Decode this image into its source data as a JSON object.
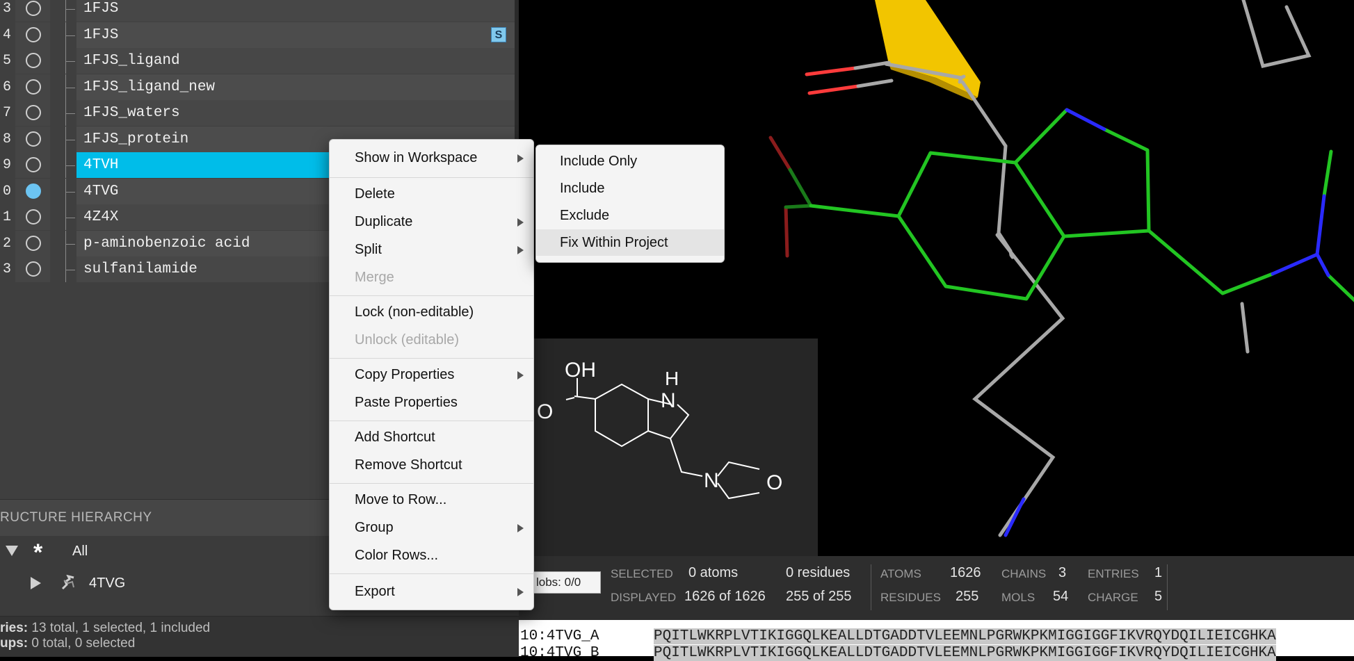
{
  "entries": [
    {
      "num": "3",
      "title": "1FJS",
      "included": false,
      "selected": false,
      "shortcut": ""
    },
    {
      "num": "4",
      "title": "1FJS",
      "included": false,
      "selected": false,
      "shortcut": "S"
    },
    {
      "num": "5",
      "title": "1FJS_ligand",
      "included": false,
      "selected": false,
      "shortcut": ""
    },
    {
      "num": "6",
      "title": "1FJS_ligand_new",
      "included": false,
      "selected": false,
      "shortcut": ""
    },
    {
      "num": "7",
      "title": "1FJS_waters",
      "included": false,
      "selected": false,
      "shortcut": ""
    },
    {
      "num": "8",
      "title": "1FJS_protein",
      "included": false,
      "selected": false,
      "shortcut": ""
    },
    {
      "num": "9",
      "title": "4TVH",
      "included": false,
      "selected": true,
      "shortcut": ""
    },
    {
      "num": "0",
      "title": "4TVG",
      "included": true,
      "selected": false,
      "shortcut": ""
    },
    {
      "num": "1",
      "title": "4Z4X",
      "included": false,
      "selected": false,
      "shortcut": ""
    },
    {
      "num": "2",
      "title": "p-aminobenzoic acid",
      "included": false,
      "selected": false,
      "shortcut": ""
    },
    {
      "num": "3",
      "title": "sulfanilamide",
      "included": false,
      "selected": false,
      "shortcut": ""
    }
  ],
  "hierarchy": {
    "header": "RUCTURE HIERARCHY",
    "all_label": "All",
    "child_label": "4TVG"
  },
  "status": {
    "entries_label": "ries:",
    "entries_text": "13 total, 1 selected, 1 included",
    "groups_label": "ups:",
    "groups_text": "0 total, 0 selected"
  },
  "context_menu": {
    "items": [
      {
        "label": "Show in Workspace",
        "submenu": true,
        "disabled": false
      },
      {
        "label": "Delete",
        "submenu": false,
        "disabled": false
      },
      {
        "label": "Duplicate",
        "submenu": true,
        "disabled": false
      },
      {
        "label": "Split",
        "submenu": true,
        "disabled": false
      },
      {
        "label": "Merge",
        "submenu": false,
        "disabled": true
      },
      {
        "label": "Lock (non-editable)",
        "submenu": false,
        "disabled": false
      },
      {
        "label": "Unlock (editable)",
        "submenu": false,
        "disabled": true
      },
      {
        "label": "Copy Properties",
        "submenu": true,
        "disabled": false
      },
      {
        "label": "Paste Properties",
        "submenu": false,
        "disabled": false
      },
      {
        "label": "Add Shortcut",
        "submenu": false,
        "disabled": false
      },
      {
        "label": "Remove Shortcut",
        "submenu": false,
        "disabled": false
      },
      {
        "label": "Move to Row...",
        "submenu": false,
        "disabled": false
      },
      {
        "label": "Group",
        "submenu": true,
        "disabled": false
      },
      {
        "label": "Color Rows...",
        "submenu": false,
        "disabled": false
      },
      {
        "label": "Export",
        "submenu": true,
        "disabled": false
      }
    ]
  },
  "submenu": {
    "items": [
      "Include Only",
      "Include",
      "Exclude",
      "Fix Within Project"
    ],
    "highlighted": "Fix Within Project"
  },
  "sketch_labels": {
    "oh": "OH",
    "h": "H",
    "n1": "N",
    "n2": "N",
    "o_ring": "O",
    "o_left": "O"
  },
  "info": {
    "blobs": "lobs: 0/0",
    "selected_label": "SELECTED",
    "selected_atoms": "0 atoms",
    "selected_residues": "0 residues",
    "displayed_label": "DISPLAYED",
    "displayed_atoms": "1626 of 1626",
    "displayed_residues": "255 of 255",
    "atoms_label": "ATOMS",
    "atoms": "1626",
    "chains_label": "CHAINS",
    "chains": "3",
    "entries_label": "ENTRIES",
    "entries": "1",
    "residues_label": "RESIDUES",
    "residues": "255",
    "mols_label": "MOLS",
    "mols": "54",
    "charge_label": "CHARGE",
    "charge": "5"
  },
  "sequence": {
    "rows": [
      {
        "name": "10:4TVG_A",
        "seq": "PQITLWKRPLVTIKIGGQLKEALLDTGADDTVLEEMNLPGRWKPKMIGGIGGFIKVRQYDQILIEICGHKA"
      },
      {
        "name": "10:4TVG_B",
        "seq": "PQITLWKRPLVTIKIGGQLKEALLDTGADDTVLEEMNLPGRWKPKMIGGIGGFIKVRQYDQILIEICGHKA"
      }
    ]
  },
  "colors": {
    "selection": "#00bde9",
    "included": "#6cc4f2",
    "carbon_green": "#22c522",
    "nitrogen": "#2a2aff",
    "oxygen": "#ff3b3b",
    "ribbon": "#f2c500"
  }
}
